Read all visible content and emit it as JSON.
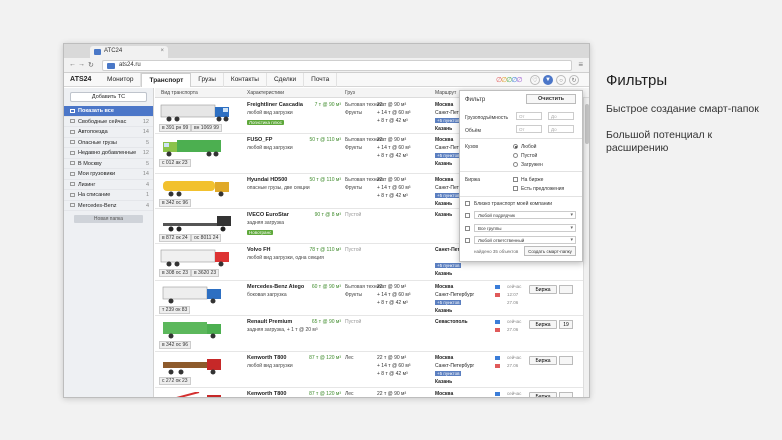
{
  "captions": {
    "title": "Фильтры",
    "line1": "Быстрое создание смарт-папок",
    "line2": "Большой потенциал к расширению"
  },
  "browser": {
    "tab_title": "АТС24",
    "url": "ats24.ru",
    "menu_icon": "hamburger-menu-icon"
  },
  "app": {
    "logo": "АТS24",
    "nav": [
      "Монитор",
      "Транспорт",
      "Грузы",
      "Контакты",
      "Сделки",
      "Почта"
    ],
    "active_nav": "Транспорт"
  },
  "sidebar": {
    "add_button": "Добавить ТС",
    "items": [
      {
        "label": "Показать все",
        "count": ""
      },
      {
        "label": "Свободные сейчас",
        "count": "12"
      },
      {
        "label": "Автопоезда",
        "count": "14"
      },
      {
        "label": "Опасные грузы",
        "count": "5"
      },
      {
        "label": "Недавно добавленные",
        "count": "12"
      },
      {
        "label": "В Москву",
        "count": "5"
      },
      {
        "label": "Мои грузовики",
        "count": "14"
      },
      {
        "label": "Лизинг",
        "count": "4"
      },
      {
        "label": "На списание",
        "count": "1"
      },
      {
        "label": "Mercedes-Benz",
        "count": "4"
      }
    ],
    "new_folder": "Новая папка"
  },
  "table": {
    "headers": [
      "Вид транспорта",
      "Характеристики",
      "Груз",
      "Маршрут"
    ],
    "rows": [
      {
        "plate": "в 391 рн 99",
        "plate2": "вн 1069 99",
        "model": "Freightliner Cascadia",
        "cap": "7 т @ 90 м³",
        "desc": "любой вид загрузки",
        "badge": "Логистика плюс",
        "cargo": "Бытовая техника",
        "cargo2": "Фрукты",
        "route": "22 т @ 90 м³",
        "route2": "+ 14 т @ 60 м³",
        "route3": "+ 8 т @ 42 м³",
        "from": "Москва",
        "to": "Санкт-Петербург",
        "pts": "+5 пунктов",
        "last": "Казань",
        "truck": "blue-semi"
      },
      {
        "plate": "с 012 ак 23",
        "plate2": "",
        "model": "FUSO_FP",
        "cap": "50 т @ 110 м³",
        "desc": "любой вид загрузки",
        "badge": "",
        "cargo": "Бытовая техника",
        "cargo2": "Фрукты",
        "route": "22 т @ 90 м³",
        "route2": "+ 14 т @ 60 м³",
        "route3": "+ 8 т @ 42 м³",
        "from": "Москва",
        "to": "Санкт-Петербург",
        "pts": "+5 пунктов",
        "last": "Казань",
        "truck": "green-box"
      },
      {
        "plate": "в 342 ос 96",
        "plate2": "",
        "model": "Hyundai HD500",
        "cap": "50 т @ 110 м³",
        "desc": "опасные грузы, две секции",
        "badge": "",
        "cargo": "Бытовая техника",
        "cargo2": "Фрукты",
        "route": "22 т @ 90 м³",
        "route2": "+ 14 т @ 60 м³",
        "route3": "+ 8 т @ 42 м³",
        "from": "Москва",
        "to": "Санкт-Петербург",
        "pts": "+5 пунктов",
        "last": "Казань",
        "truck": "yellow-tanker"
      },
      {
        "plate": "в 872 ок 24",
        "plate2": "ос 8011 24",
        "model": "IVECO EuroStar",
        "cap": "90 т @ 8 м³",
        "desc": "задняя загрузка",
        "badge": "Новотранс",
        "cargo": "Пустой",
        "cargo2": "",
        "route": "",
        "route2": "",
        "route3": "",
        "from": "Казань",
        "to": "",
        "pts": "",
        "last": "",
        "truck": "black-flatbed"
      },
      {
        "plate": "в 308 ос 23",
        "plate2": "в 3620 23",
        "model": "Volvo FH",
        "cap": "78 т @ 110 м³",
        "desc": "любой вид загрузки, одна секция",
        "badge": "",
        "cargo": "Пустой",
        "cargo2": "",
        "route": "",
        "route2": "",
        "route3": "",
        "from": "Санкт-Петербург",
        "to": "",
        "pts": "+5 пунктов",
        "last": "Казань",
        "truck": "red-semi"
      },
      {
        "plate": "т 239 ок 83",
        "plate2": "",
        "model": "Mercedes-Benz Atego",
        "cap": "60 т @ 90 м³",
        "desc": "боковая загрузка",
        "badge": "",
        "cargo": "Бытовая техника",
        "cargo2": "Фрукты",
        "route": "22 т @ 90 м³",
        "route2": "+ 14 т @ 60 м³",
        "route3": "+ 8 т @ 42 м³",
        "from": "Москва",
        "to": "Санкт-Петербург",
        "pts": "+5 пунктов",
        "last": "Казань",
        "truck": "blue-box",
        "status": "сейчас",
        "status2": "12:07",
        "status3": "27.06",
        "btn": "Биржа"
      },
      {
        "plate": "в 342 ос 96",
        "plate2": "",
        "model": "Renault Premium",
        "cap": "65 т @ 90 м³",
        "desc": "задняя загрузка, + 1 т @ 20 м³",
        "badge": "",
        "cargo": "Пустой",
        "cargo2": "",
        "route": "",
        "route2": "",
        "route3": "",
        "from": "Севастополь",
        "to": "",
        "pts": "",
        "last": "",
        "truck": "green-box2",
        "status": "сейчас",
        "status2": "27.06",
        "status3": "",
        "btn": "Биржа",
        "btn2": "19"
      },
      {
        "plate": "с 272 ок 23",
        "plate2": "",
        "model": "Kenworth T800",
        "cap": "87 т @ 120 м³",
        "desc": "любой вид загрузки",
        "badge": "",
        "cargo": "Лес",
        "cargo2": "",
        "route": "22 т @ 90 м³",
        "route2": "+ 14 т @ 60 м³",
        "route3": "+ 8 т @ 42 м³",
        "from": "Москва",
        "to": "Санкт-Петербург",
        "pts": "+5 пунктов",
        "last": "Казань",
        "truck": "red-logger",
        "status": "сейчас",
        "status2": "27.06",
        "status3": "",
        "btn": "Биржа"
      },
      {
        "plate": "",
        "plate2": "",
        "model": "Kenworth T800",
        "cap": "87 т @ 120 м³",
        "desc": "любой вид загрузки",
        "badge": "",
        "cargo": "Лес",
        "cargo2": "",
        "route": "22 т @ 90 м³",
        "route2": "+ 14 т @ 60 м³",
        "route3": "",
        "from": "Москва",
        "to": "Санкт-Петербург",
        "pts": "+5 пунктов",
        "last": "",
        "truck": "red-crane",
        "status": "сейчас",
        "status2": "12:07",
        "status3": "",
        "btn": "Биржа"
      }
    ]
  },
  "filter": {
    "title": "Фильтр",
    "clear": "Очистить",
    "capacity": "Грузоподъёмность",
    "volume": "Объём",
    "from_ph": "От",
    "to_ph": "До",
    "kuzov": "Кузов",
    "radio": [
      "Любой",
      "Пустой",
      "Загружен"
    ],
    "birzha": "Биржа",
    "chk1": "На бирже",
    "chk2": "Есть предложения",
    "own": "Близко транспорт моей компании",
    "sel1": "Любой подрядчик",
    "sel2": "Все группы",
    "sel3": "Любой ответственный",
    "found": "найдено 35 объектов",
    "smart": "Создать смарт-папку"
  }
}
